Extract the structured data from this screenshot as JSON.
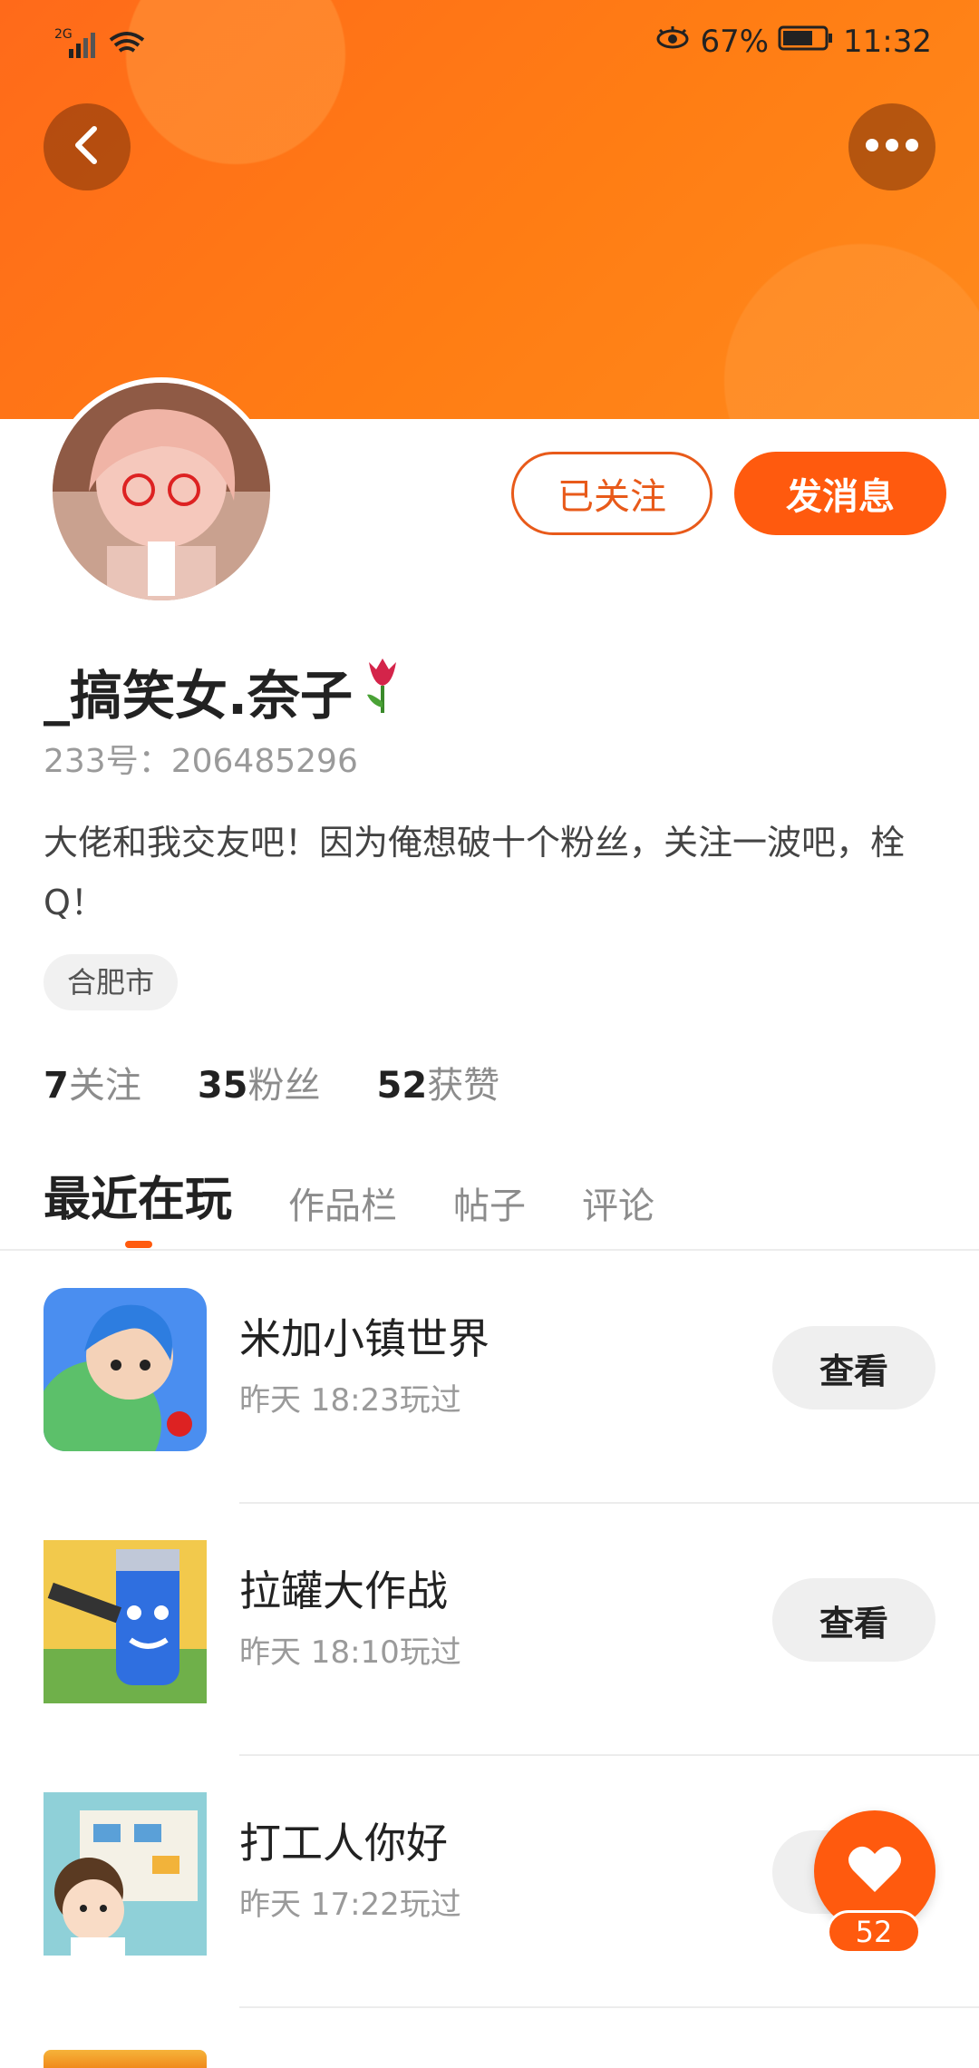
{
  "status_bar": {
    "network": "2G",
    "battery_pct": "67%",
    "time": "11:32"
  },
  "header": {
    "back_icon": "chevron-left-icon",
    "more_icon": "more-dots-icon"
  },
  "profile": {
    "follow_label": "已关注",
    "message_label": "发消息",
    "name": "_搞笑女.奈子",
    "id_line": "233号：206485296",
    "bio": "大佬和我交友吧！因为俺想破十个粉丝，关注一波吧，栓Q！",
    "location": "合肥市",
    "stats": [
      {
        "count": "7",
        "label": "关注"
      },
      {
        "count": "35",
        "label": "粉丝"
      },
      {
        "count": "52",
        "label": "获赞"
      }
    ]
  },
  "tabs": [
    "最近在玩",
    "作品栏",
    "帖子",
    "评论"
  ],
  "games": [
    {
      "title": "米加小镇世界",
      "time": "昨天 18:23玩过",
      "action": "查看"
    },
    {
      "title": "拉罐大作战",
      "time": "昨天 18:10玩过",
      "action": "查看"
    },
    {
      "title": "打工人你好",
      "time": "昨天 17:22玩过",
      "action": "查看"
    }
  ],
  "fab": {
    "count": "52"
  },
  "colors": {
    "accent": "#ff5a0e",
    "banner": "#ff7a14"
  }
}
